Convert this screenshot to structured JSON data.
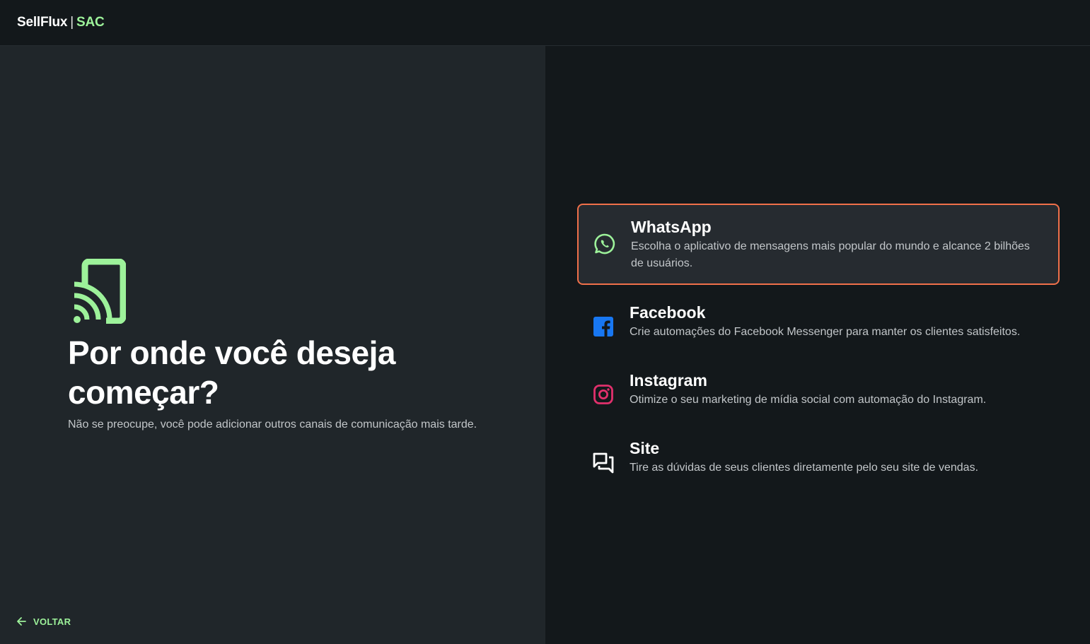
{
  "header": {
    "brand_name": "SellFlux",
    "separator": "|",
    "brand_product": "SAC"
  },
  "hero": {
    "icon": "cast-device-icon",
    "title_line1": "Por onde você deseja",
    "title_line2": "começar?",
    "subtitle": "Não se preocupe, você pode adicionar outros canais de comunicação mais tarde."
  },
  "back": {
    "icon": "arrow-left-icon",
    "label": "VOLTAR"
  },
  "channels": [
    {
      "icon": "whatsapp-icon",
      "name": "WhatsApp",
      "description": "Escolha o aplicativo de mensagens mais popular do mundo e alcance 2 bilhões de usuários.",
      "selected": true
    },
    {
      "icon": "facebook-icon",
      "name": "Facebook",
      "description": "Crie automações do Facebook Messenger para manter os clientes satisfeitos.",
      "selected": false
    },
    {
      "icon": "instagram-icon",
      "name": "Instagram",
      "description": "Otimize o seu marketing de mídia social com automação do Instagram.",
      "selected": false
    },
    {
      "icon": "chat-bubbles-icon",
      "name": "Site",
      "description": "Tire as dúvidas de seus clientes diretamente pelo seu site de vendas.",
      "selected": false
    }
  ],
  "colors": {
    "accent_green": "#9df29a",
    "selected_border": "#f0704a",
    "whatsapp": "#9df29a",
    "facebook": "#1877f2",
    "instagram": "#e1306c"
  }
}
